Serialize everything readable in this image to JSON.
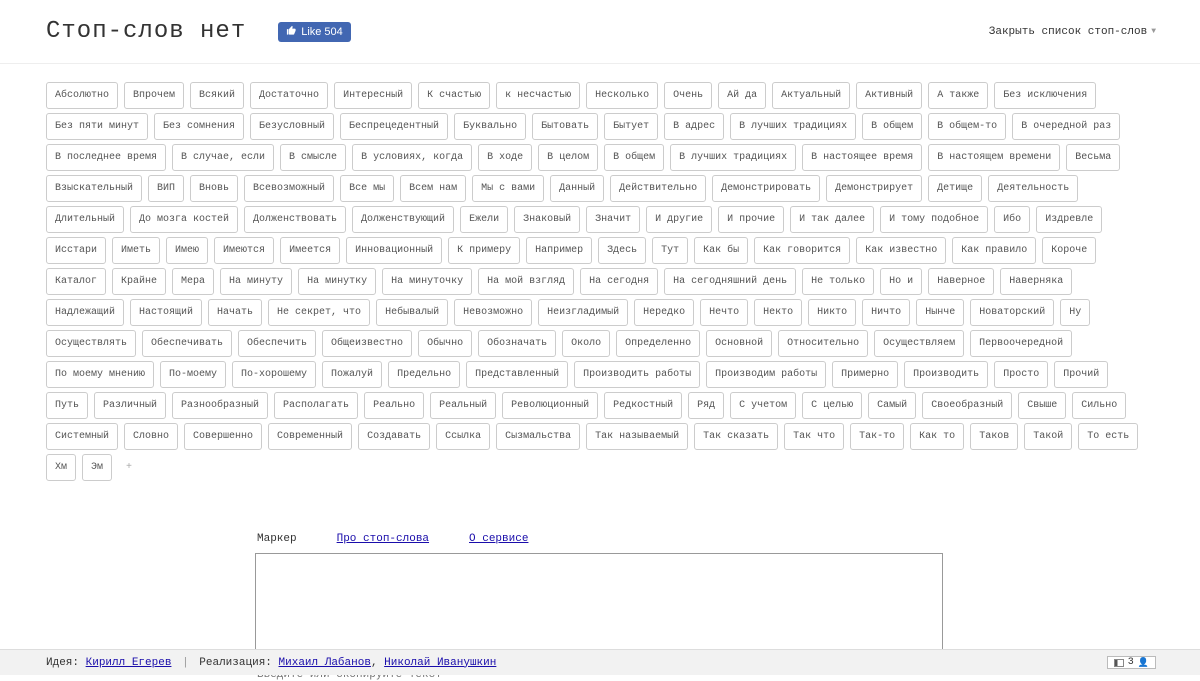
{
  "header": {
    "title": "Стоп-слов нет",
    "like_label": "Like",
    "like_count": "504",
    "toggle_label": "Закрыть список стоп-слов"
  },
  "words": [
    "Абсолютно",
    "Впрочем",
    "Всякий",
    "Достаточно",
    "Интересный",
    "К счастью",
    "к несчастью",
    "Несколько",
    "Очень",
    "Ай да",
    "Актуальный",
    "Активный",
    "А также",
    "Без исключения",
    "Без пяти минут",
    "Без сомнения",
    "Безусловный",
    "Беспрецедентный",
    "Буквально",
    "Бытовать",
    "Бытует",
    "В адрес",
    "В лучших традициях",
    "В общем",
    "В общем-то",
    "В очередной раз",
    "В последнее время",
    "В случае, если",
    "В смысле",
    "В условиях, когда",
    "В ходе",
    "В целом",
    "В общем",
    "В лучших традициях",
    "В настоящее время",
    "В настоящем времени",
    "Весьма",
    "Взыскательный",
    "ВИП",
    "Вновь",
    "Всевозможный",
    "Все мы",
    "Всем нам",
    "Мы с вами",
    "Данный",
    "Действительно",
    "Демонстрировать",
    "Демонстрирует",
    "Детище",
    "Деятельность",
    "Длительный",
    "До мозга костей",
    "Долженствовать",
    "Долженствующий",
    "Ежели",
    "Знаковый",
    "Значит",
    "И другие",
    "И прочие",
    "И так далее",
    "И тому подобное",
    "Ибо",
    "Издревле",
    "Исстари",
    "Иметь",
    "Имею",
    "Имеются",
    "Имеется",
    "Инновационный",
    "К примеру",
    "Например",
    "Здесь",
    "Тут",
    "Как бы",
    "Как говорится",
    "Как известно",
    "Как правило",
    "Короче",
    "Каталог",
    "Крайне",
    "Мера",
    "На минуту",
    "На минутку",
    "На минуточку",
    "На мой взгляд",
    "На сегодня",
    "На сегодняшний день",
    "Не только",
    "Но и",
    "Наверное",
    "Наверняка",
    "Надлежащий",
    "Настоящий",
    "Начать",
    "Не секрет, что",
    "Небывалый",
    "Невозможно",
    "Неизгладимый",
    "Нередко",
    "Нечто",
    "Некто",
    "Никто",
    "Ничто",
    "Нынче",
    "Новаторский",
    "Ну",
    "Осуществлять",
    "Обеспечивать",
    "Обеспечить",
    "Общеизвестно",
    "Обычно",
    "Обозначать",
    "Около",
    "Определенно",
    "Основной",
    "Относительно",
    "Осуществляем",
    "Первоочередной",
    "По моему мнению",
    "По-моему",
    "По-хорошему",
    "Пожалуй",
    "Предельно",
    "Представленный",
    "Производить работы",
    "Производим работы",
    "Примерно",
    "Производить",
    "Просто",
    "Прочий",
    "Путь",
    "Различный",
    "Разнообразный",
    "Располагать",
    "Реально",
    "Реальный",
    "Революционный",
    "Редкостный",
    "Ряд",
    "С учетом",
    "С целью",
    "Самый",
    "Своеобразный",
    "Свыше",
    "Сильно",
    "Системный",
    "Словно",
    "Совершенно",
    "Современный",
    "Создавать",
    "Ссылка",
    "Сызмальства",
    "Так называемый",
    "Так сказать",
    "Так что",
    "Так-то",
    "Как то",
    "Таков",
    "Такой",
    "То есть",
    "Хм",
    "Эм"
  ],
  "plus": "+",
  "tabs": {
    "marker": "Маркер",
    "about_words": "Про стоп-слова",
    "about_service": "О сервисе"
  },
  "editor": {
    "placeholder_hint": "Введите или скопируйте текст"
  },
  "footer": {
    "idea_label": "Идея:",
    "idea_name": "Кирилл Егерев",
    "impl_label": "Реализация:",
    "impl_name1": "Михаил Лабанов",
    "impl_name2": "Николай Иванушкин",
    "counter_value": "3"
  }
}
